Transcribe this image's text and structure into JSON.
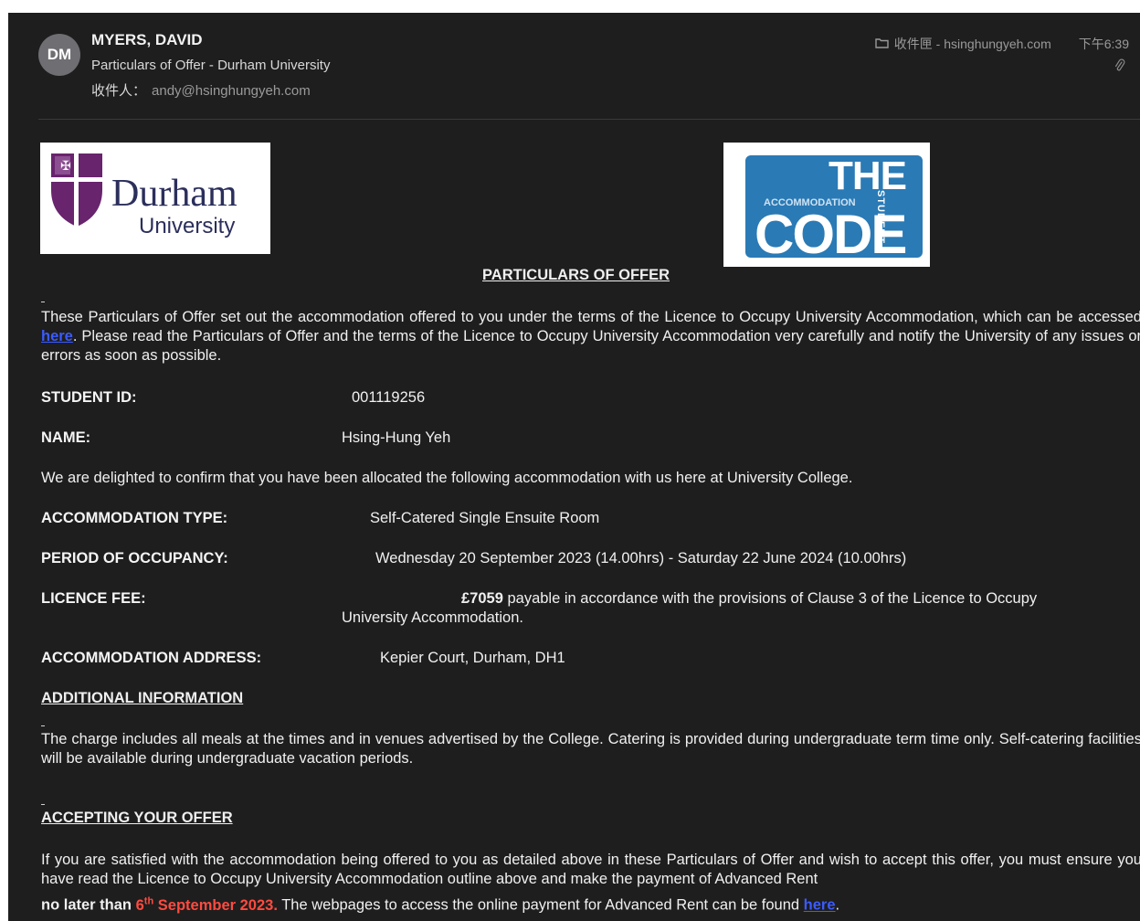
{
  "header": {
    "avatar_initials": "DM",
    "sender": "MYERS, DAVID",
    "subject": "Particulars of Offer - Durham University",
    "recipient_label": "收件人：",
    "recipient_address": "andy@hsinghungyeh.com",
    "mailbox": "收件匣 - hsinghungyeh.com",
    "time": "下午6:39",
    "icons": [
      "folder-icon",
      "paperclip-icon"
    ]
  },
  "logos": {
    "durham_line1": "Durham",
    "durham_line2": "University",
    "code_the": "THE",
    "code_accommodation": "ACCOMMODATION",
    "code_code": "CODE",
    "code_student": "STUDENT"
  },
  "document": {
    "title": "PARTICULARS OF OFFER",
    "intro_part1": "These Particulars of Offer set out the accommodation offered to you under the terms of the Licence to Occupy University Accommodation, which can be accessed ",
    "intro_link": "here",
    "intro_part2": ".   Please read the Particulars of Offer and the terms of the Licence to Occupy University Accommodation very carefully and notify the University of any issues or errors as soon as possible.",
    "student_id_label": "STUDENT ID:",
    "student_id_value": "001119256",
    "name_label": "NAME:",
    "name_value": "Hsing-Hung Yeh",
    "allocation_text": "We are delighted to confirm that you have been allocated the following accommodation with us here at University College.",
    "type_label": "ACCOMMODATION TYPE:",
    "type_value": "Self-Catered Single Ensuite Room",
    "period_label": "PERIOD OF OCCUPANCY:",
    "period_value": "Wednesday 20 September 2023 (14.00hrs) - Saturday 22 June 2024 (10.00hrs)",
    "fee_label": "LICENCE FEE:",
    "fee_amount": "£7059",
    "fee_text_line1": " payable in accordance with the provisions of Clause 3 of the Licence to Occupy",
    "fee_text_line2": "University Accommodation.",
    "address_label": "ACCOMMODATION ADDRESS:",
    "address_value": "Kepier Court, Durham, DH1",
    "additional_heading": "ADDITIONAL INFORMATION",
    "additional_text": "The charge includes all meals at the times and in venues advertised by the College. Catering is provided during undergraduate term time only.  Self-catering facilities will be available during undergraduate vacation periods.",
    "accepting_heading": "ACCEPTING YOUR OFFER",
    "accepting_text": "If you are satisfied with the accommodation being offered to you as detailed above in these Particulars of Offer and wish to accept this offer, you must ensure you have read the Licence to Occupy University Accommodation outline above and make the payment of Advanced Rent",
    "deadline_prefix": "no later than ",
    "deadline_day": "6",
    "deadline_suffix": "th",
    "deadline_month": " September 2023.",
    "payment_text": " The webpages to access the online payment for Advanced Rent can be found ",
    "payment_link": "here",
    "payment_end": "."
  },
  "colors": {
    "background": "#1e1e1e",
    "link": "#3b5bff",
    "deadline": "#ff4b40",
    "durham_purple": "#68246d",
    "code_blue": "#2a7ab5"
  }
}
